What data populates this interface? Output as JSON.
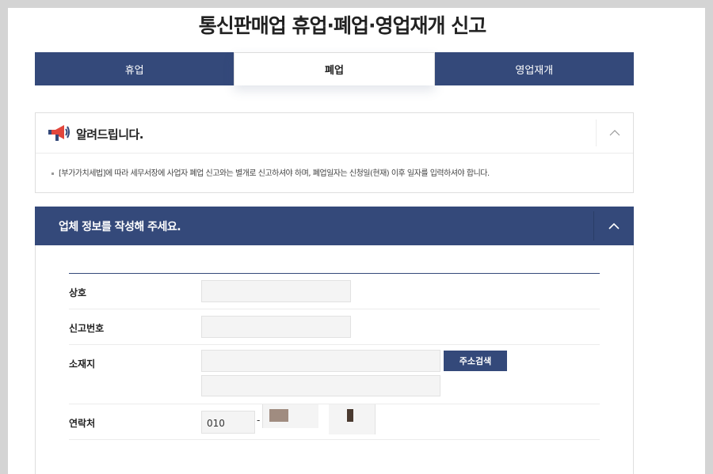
{
  "page": {
    "title": "통신판매업 휴업·폐업·영업재개 신고"
  },
  "tabs": [
    {
      "label": "휴업",
      "active": false
    },
    {
      "label": "폐업",
      "active": true
    },
    {
      "label": "영업재개",
      "active": false
    }
  ],
  "notice": {
    "title": "알려드립니다.",
    "icon": "megaphone-icon",
    "text": "[부가가치세법]에 따라 세무서장에 사업자 폐업 신고와는 별개로 신고하셔야 하며, 폐업일자는 신청일(현재) 이후 일자를 입력하셔야 합니다."
  },
  "form": {
    "title": "업체 정보를 작성해 주세요.",
    "fields": {
      "company_name": {
        "label": "상호",
        "value": ""
      },
      "report_number": {
        "label": "신고번호",
        "value": ""
      },
      "address": {
        "label": "소재지",
        "value": "",
        "detail": "",
        "search_label": "주소검색"
      },
      "contact": {
        "label": "연락처",
        "first": "010",
        "separator": "-"
      }
    }
  },
  "colors": {
    "primary": "#34497a",
    "input_bg": "#f4f4f4",
    "background": "#d4d4d4"
  }
}
